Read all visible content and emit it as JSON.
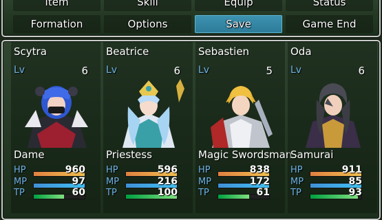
{
  "menu": {
    "commands": [
      "Item",
      "Skill",
      "Equip",
      "Status",
      "Formation",
      "Options",
      "Save",
      "Game End"
    ],
    "selected": "Save"
  },
  "labels": {
    "lv": "Lv",
    "hp": "HP",
    "mp": "MP",
    "tp": "TP"
  },
  "party": [
    {
      "name": "Scytra",
      "level": "6",
      "class": "Dame",
      "hp": "960",
      "mp": "97",
      "tp": "60",
      "hp_fill": 1.0,
      "mp_fill": 1.0,
      "tp_fill": 0.6
    },
    {
      "name": "Beatrice",
      "level": "6",
      "class": "Priestess",
      "hp": "596",
      "mp": "216",
      "tp": "100",
      "hp_fill": 1.0,
      "mp_fill": 1.0,
      "tp_fill": 1.0
    },
    {
      "name": "Sebastien",
      "level": "5",
      "class": "Magic Swordsman",
      "hp": "838",
      "mp": "172",
      "tp": "61",
      "hp_fill": 1.0,
      "mp_fill": 1.0,
      "tp_fill": 0.61
    },
    {
      "name": "Oda",
      "level": "6",
      "class": "Samurai",
      "hp": "911",
      "mp": "85",
      "tp": "93",
      "hp_fill": 1.0,
      "mp_fill": 1.0,
      "tp_fill": 0.93
    }
  ],
  "colors": {
    "selected_command": "#2c7b98",
    "stat_label": "#6fb2e6",
    "window_border": "#c9ccc9"
  }
}
